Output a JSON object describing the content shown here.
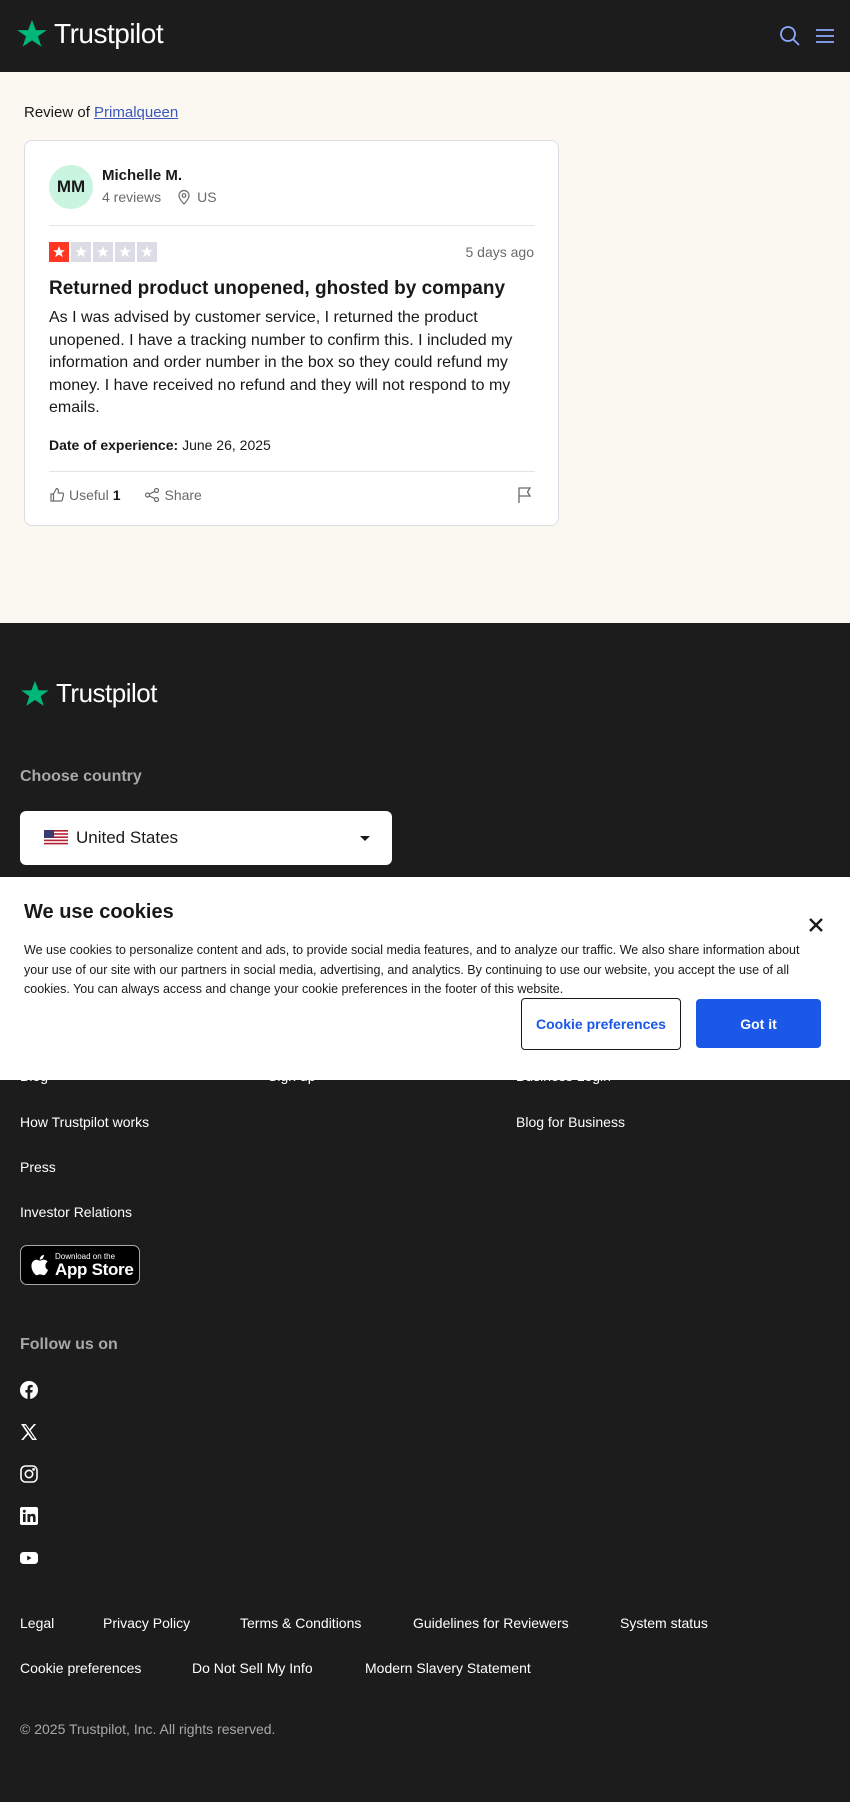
{
  "header": {
    "brand": "Trustpilot",
    "search_icon": "search-icon",
    "menu_icon": "hamburger-menu-icon"
  },
  "review_of": {
    "prefix": "Review of",
    "company": "Primalqueen"
  },
  "review": {
    "avatar_initials": "MM",
    "user_name": "Michelle M.",
    "review_count": "4 reviews",
    "country": "US",
    "rating": 1,
    "rating_max": 5,
    "date": "5 days ago",
    "title": "Returned product unopened, ghosted by company",
    "body": "As I was advised by customer service, I returned the product unopened. I have a tracking number to confirm this. I included my information and order number in the box so they could refund my money. I have received no refund and they will not respond to my emails.",
    "experience_label": "Date of experience:",
    "experience_date": "June 26, 2025",
    "useful_label": "Useful",
    "useful_count": "1",
    "share_label": "Share"
  },
  "colors": {
    "accent_green": "#00b67a",
    "star_red": "#ff3722",
    "primary_blue": "#1b58e8",
    "link_blue": "#3c57bc"
  },
  "footer": {
    "brand": "Trustpilot",
    "choose_country": "Choose country",
    "country": "United States",
    "links_col1": [
      "Blog",
      "How Trustpilot works",
      "Press",
      "Investor Relations"
    ],
    "links_col2": [
      "Sign up"
    ],
    "links_col3": [
      "Business Login",
      "Blog for Business"
    ],
    "appstore_small": "Download on the",
    "appstore_big": "App Store",
    "follow": "Follow us on",
    "social": [
      "facebook-icon",
      "x-icon",
      "instagram-icon",
      "linkedin-icon",
      "youtube-icon"
    ],
    "legal_row1": [
      "Legal",
      "Privacy Policy",
      "Terms & Conditions",
      "Guidelines for Reviewers",
      "System status"
    ],
    "legal_row2": [
      "Cookie preferences",
      "Do Not Sell My Info",
      "Modern Slavery Statement"
    ],
    "copyright": "© 2025 Trustpilot, Inc. All rights reserved."
  },
  "cookie": {
    "title": "We use cookies",
    "text": "We use cookies to personalize content and ads, to provide social media features, and to analyze our traffic. We also share information about your use of our site with our partners in social media, advertising, and analytics. By continuing to use our website, you accept the use of all cookies. You can always access and change your cookie preferences in the footer of this website.",
    "preferences_button": "Cookie preferences",
    "accept_button": "Got it"
  }
}
